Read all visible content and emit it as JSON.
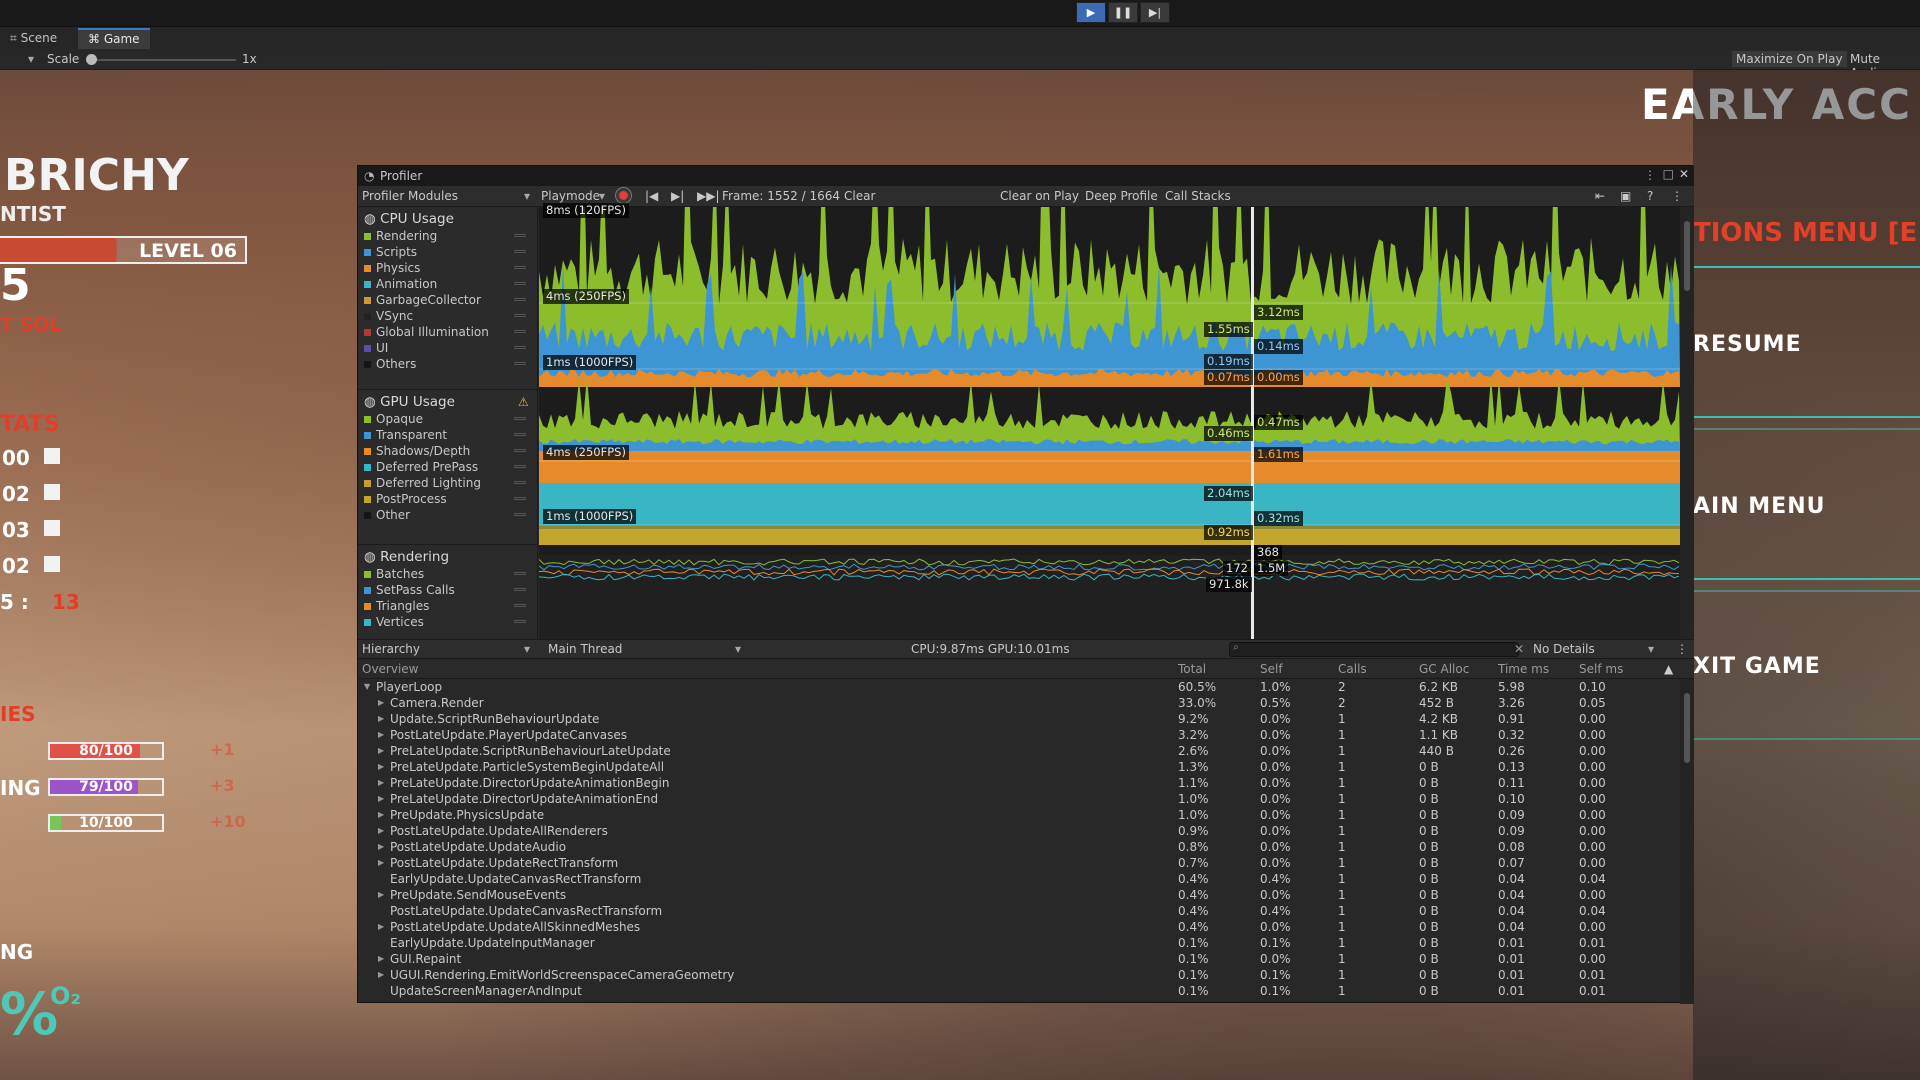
{
  "toolbar": {
    "play_icon": "play-icon",
    "pause_icon": "pause-icon",
    "step_icon": "step-icon"
  },
  "tabs": [
    {
      "label": "Scene",
      "icon": "grid-icon"
    },
    {
      "label": "Game",
      "icon": "gamepad-icon"
    }
  ],
  "scale": {
    "label": "Scale",
    "value": "1x",
    "maximize_label": "Maximize On Play",
    "mute_label": "Mute Audio"
  },
  "game": {
    "name": "BRICHY",
    "role": "NTIST",
    "level": "LEVEL 06",
    "big_num": "5",
    "red_sub": "T SOL",
    "stats_title": "TATS",
    "stat_rows": [
      "00",
      "02",
      "03",
      "02"
    ],
    "stat5": "5 :",
    "stat5_val": "13",
    "section2": "IES",
    "bars": [
      {
        "label": "",
        "value": "80/100",
        "pct": 0.8,
        "color": "#e05248",
        "extra": "+1"
      },
      {
        "label": "ING",
        "value": "79/100",
        "pct": 0.79,
        "color": "#9c55c8",
        "extra": "+3"
      },
      {
        "label": "",
        "value": "10/100",
        "pct": 0.1,
        "color": "#78c65a",
        "extra": "+10"
      }
    ],
    "ng": "NG",
    "pct_big": "%",
    "o2": "O₂",
    "early": "EARLY ACC",
    "options_menu": "TIONS MENU [E",
    "resume": "RESUME",
    "main_menu": "AIN MENU",
    "exit_game": "XIT GAME"
  },
  "profiler": {
    "title": "Profiler",
    "modules_dropdown": "Profiler Modules",
    "playmode": "Playmode",
    "frame": "Frame: 1552 / 1664",
    "clear": "Clear",
    "clear_on_play": "Clear on Play",
    "deep_profile": "Deep Profile",
    "call_stacks": "Call Stacks",
    "cpu": {
      "title": "CPU Usage",
      "legend": [
        {
          "name": "Rendering",
          "color": "#8cbd2c"
        },
        {
          "name": "Scripts",
          "color": "#3e95d3"
        },
        {
          "name": "Physics",
          "color": "#e58b2c"
        },
        {
          "name": "Animation",
          "color": "#3ab5c4"
        },
        {
          "name": "GarbageCollector",
          "color": "#c99a34"
        },
        {
          "name": "VSync",
          "color": "#222222"
        },
        {
          "name": "Global Illumination",
          "color": "#b03838"
        },
        {
          "name": "UI",
          "color": "#5a4fa8"
        },
        {
          "name": "Others",
          "color": "#151515"
        }
      ]
    },
    "gpu": {
      "title": "GPU Usage",
      "warn_icon": "warning-icon",
      "legend": [
        {
          "name": "Opaque",
          "color": "#8cbd2c"
        },
        {
          "name": "Transparent",
          "color": "#3e95d3"
        },
        {
          "name": "Shadows/Depth",
          "color": "#e58b2c"
        },
        {
          "name": "Deferred PrePass",
          "color": "#3ab5c4"
        },
        {
          "name": "Deferred Lighting",
          "color": "#c99a34"
        },
        {
          "name": "PostProcess",
          "color": "#c1a52c"
        },
        {
          "name": "Other",
          "color": "#151515"
        }
      ]
    },
    "rendering": {
      "title": "Rendering",
      "legend": [
        {
          "name": "Batches",
          "color": "#8cbd2c"
        },
        {
          "name": "SetPass Calls",
          "color": "#3e95d3"
        },
        {
          "name": "Triangles",
          "color": "#e58b2c"
        },
        {
          "name": "Vertices",
          "color": "#3ab5c4"
        }
      ]
    },
    "chart_labels": {
      "cpu_top": "8ms (120FPS)",
      "cpu_4ms": "4ms (250FPS)",
      "cpu_1ms": "1ms (1000FPS)",
      "gpu_4ms": "4ms (250FPS)",
      "gpu_1ms": "1ms (1000FPS)"
    },
    "cursor_values": {
      "c1": "3.12ms",
      "c2": "1.55ms",
      "c3": "0.14ms",
      "c4": "0.19ms",
      "c5": "0.07ms",
      "c6": "0.00ms",
      "g1": "0.46ms",
      "g2": "0.47ms",
      "g3": "1.61ms",
      "g4": "2.04ms",
      "g5": "0.32ms",
      "g6": "0.92ms",
      "r1": "368",
      "r2": "172",
      "r3": "1.5M",
      "r4": "971.8k"
    },
    "hierarchy": {
      "view": "Hierarchy",
      "thread": "Main Thread",
      "cpu_gpu": "CPU:9.87ms  GPU:10.01ms",
      "details": "No Details"
    },
    "columns": {
      "overview": "Overview",
      "total": "Total",
      "self": "Self",
      "calls": "Calls",
      "gc": "GC Alloc",
      "time": "Time ms",
      "selfms": "Self ms"
    },
    "rows": [
      {
        "name": "PlayerLoop",
        "total": "60.5%",
        "self": "1.0%",
        "calls": "2",
        "gc": "6.2 KB",
        "time": "5.98",
        "selfms": "0.10",
        "level": 0,
        "arrow": "▼"
      },
      {
        "name": "Camera.Render",
        "total": "33.0%",
        "self": "0.5%",
        "calls": "2",
        "gc": "452 B",
        "time": "3.26",
        "selfms": "0.05",
        "level": 1,
        "arrow": "▶"
      },
      {
        "name": "Update.ScriptRunBehaviourUpdate",
        "total": "9.2%",
        "self": "0.0%",
        "calls": "1",
        "gc": "4.2 KB",
        "time": "0.91",
        "selfms": "0.00",
        "level": 1,
        "arrow": "▶"
      },
      {
        "name": "PostLateUpdate.PlayerUpdateCanvases",
        "total": "3.2%",
        "self": "0.0%",
        "calls": "1",
        "gc": "1.1 KB",
        "time": "0.32",
        "selfms": "0.00",
        "level": 1,
        "arrow": "▶"
      },
      {
        "name": "PreLateUpdate.ScriptRunBehaviourLateUpdate",
        "total": "2.6%",
        "self": "0.0%",
        "calls": "1",
        "gc": "440 B",
        "time": "0.26",
        "selfms": "0.00",
        "level": 1,
        "arrow": "▶"
      },
      {
        "name": "PreLateUpdate.ParticleSystemBeginUpdateAll",
        "total": "1.3%",
        "self": "0.0%",
        "calls": "1",
        "gc": "0 B",
        "time": "0.13",
        "selfms": "0.00",
        "level": 1,
        "arrow": "▶"
      },
      {
        "name": "PreLateUpdate.DirectorUpdateAnimationBegin",
        "total": "1.1%",
        "self": "0.0%",
        "calls": "1",
        "gc": "0 B",
        "time": "0.11",
        "selfms": "0.00",
        "level": 1,
        "arrow": "▶"
      },
      {
        "name": "PreLateUpdate.DirectorUpdateAnimationEnd",
        "total": "1.0%",
        "self": "0.0%",
        "calls": "1",
        "gc": "0 B",
        "time": "0.10",
        "selfms": "0.00",
        "level": 1,
        "arrow": "▶"
      },
      {
        "name": "PreUpdate.PhysicsUpdate",
        "total": "1.0%",
        "self": "0.0%",
        "calls": "1",
        "gc": "0 B",
        "time": "0.09",
        "selfms": "0.00",
        "level": 1,
        "arrow": "▶"
      },
      {
        "name": "PostLateUpdate.UpdateAllRenderers",
        "total": "0.9%",
        "self": "0.0%",
        "calls": "1",
        "gc": "0 B",
        "time": "0.09",
        "selfms": "0.00",
        "level": 1,
        "arrow": "▶"
      },
      {
        "name": "PostLateUpdate.UpdateAudio",
        "total": "0.8%",
        "self": "0.0%",
        "calls": "1",
        "gc": "0 B",
        "time": "0.08",
        "selfms": "0.00",
        "level": 1,
        "arrow": "▶"
      },
      {
        "name": "PostLateUpdate.UpdateRectTransform",
        "total": "0.7%",
        "self": "0.0%",
        "calls": "1",
        "gc": "0 B",
        "time": "0.07",
        "selfms": "0.00",
        "level": 1,
        "arrow": "▶"
      },
      {
        "name": "EarlyUpdate.UpdateCanvasRectTransform",
        "total": "0.4%",
        "self": "0.4%",
        "calls": "1",
        "gc": "0 B",
        "time": "0.04",
        "selfms": "0.04",
        "level": 1,
        "arrow": ""
      },
      {
        "name": "PreUpdate.SendMouseEvents",
        "total": "0.4%",
        "self": "0.0%",
        "calls": "1",
        "gc": "0 B",
        "time": "0.04",
        "selfms": "0.00",
        "level": 1,
        "arrow": "▶"
      },
      {
        "name": "PostLateUpdate.UpdateCanvasRectTransform",
        "total": "0.4%",
        "self": "0.4%",
        "calls": "1",
        "gc": "0 B",
        "time": "0.04",
        "selfms": "0.04",
        "level": 1,
        "arrow": ""
      },
      {
        "name": "PostLateUpdate.UpdateAllSkinnedMeshes",
        "total": "0.4%",
        "self": "0.0%",
        "calls": "1",
        "gc": "0 B",
        "time": "0.04",
        "selfms": "0.00",
        "level": 1,
        "arrow": "▶"
      },
      {
        "name": "EarlyUpdate.UpdateInputManager",
        "total": "0.1%",
        "self": "0.1%",
        "calls": "1",
        "gc": "0 B",
        "time": "0.01",
        "selfms": "0.01",
        "level": 1,
        "arrow": ""
      },
      {
        "name": "GUI.Repaint",
        "total": "0.1%",
        "self": "0.0%",
        "calls": "1",
        "gc": "0 B",
        "time": "0.01",
        "selfms": "0.00",
        "level": 1,
        "arrow": "▶"
      },
      {
        "name": "UGUI.Rendering.EmitWorldScreenspaceCameraGeometry",
        "total": "0.1%",
        "self": "0.1%",
        "calls": "1",
        "gc": "0 B",
        "time": "0.01",
        "selfms": "0.01",
        "level": 1,
        "arrow": "▶"
      },
      {
        "name": "UpdateScreenManagerAndInput",
        "total": "0.1%",
        "self": "0.1%",
        "calls": "1",
        "gc": "0 B",
        "time": "0.01",
        "selfms": "0.01",
        "level": 1,
        "arrow": ""
      }
    ]
  }
}
